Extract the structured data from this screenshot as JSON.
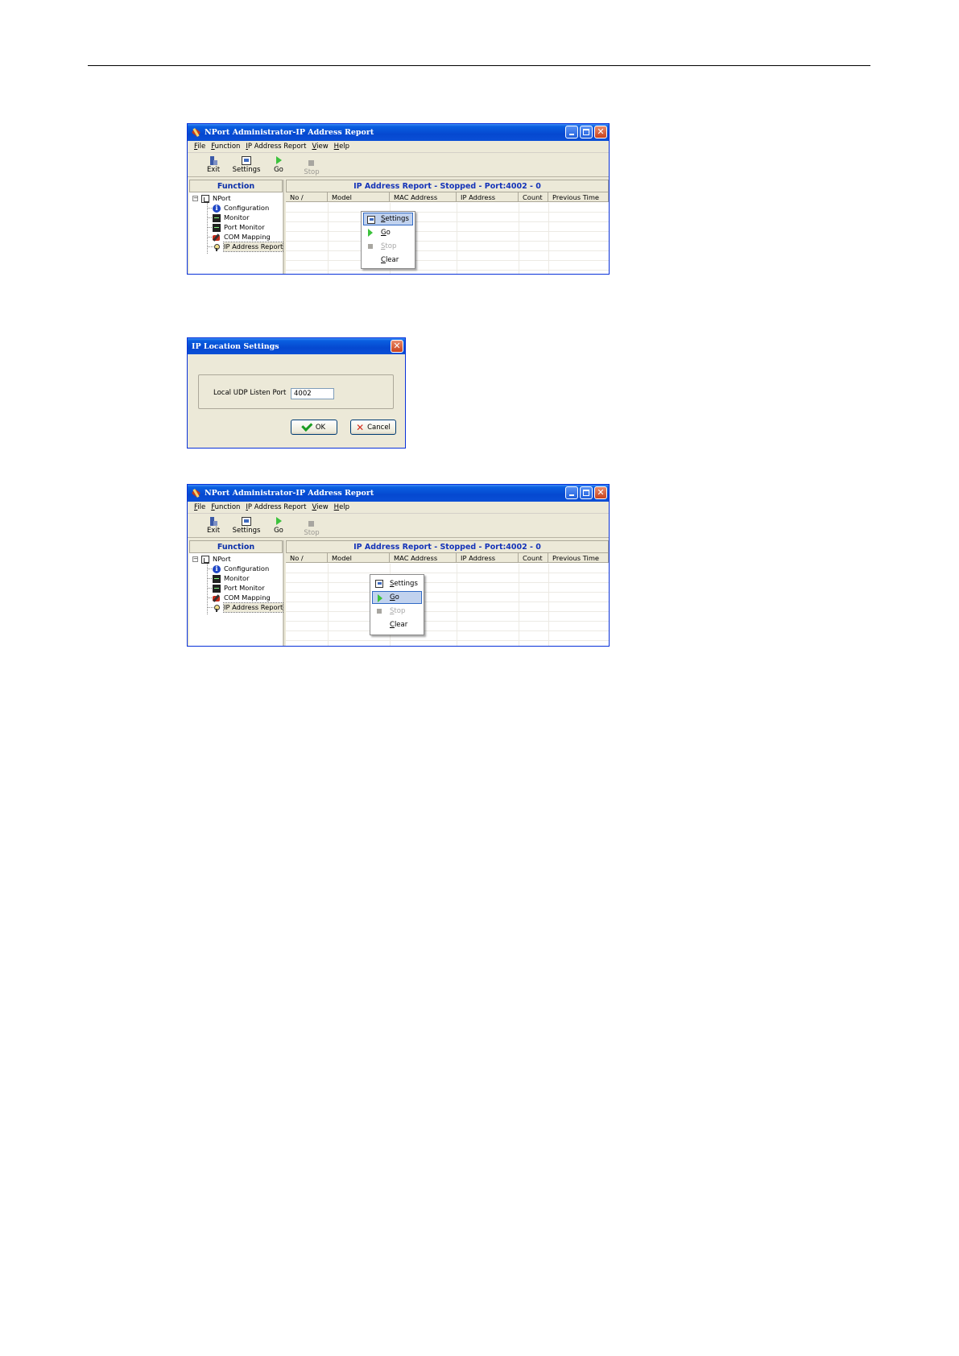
{
  "win1": {
    "title": "NPort Administrator-IP Address Report",
    "menu": [
      "File",
      "Function",
      "IP Address Report",
      "View",
      "Help"
    ],
    "toolbar": {
      "exit": "Exit",
      "settings": "Settings",
      "go": "Go",
      "stop": "Stop"
    },
    "function_header": "Function",
    "tree": {
      "root": "NPort",
      "items": [
        "Configuration",
        "Monitor",
        "Port Monitor",
        "COM Mapping",
        "IP Address Report"
      ]
    },
    "report_header": "IP Address Report - Stopped - Port:4002 - 0",
    "columns": [
      "No  /",
      "Model",
      "MAC Address",
      "IP Address",
      "Count",
      "Previous Time"
    ],
    "context_menu": [
      "Settings",
      "Go",
      "Stop",
      "Clear"
    ],
    "highlighted_item": "Settings"
  },
  "dialog": {
    "title": "IP Location Settings",
    "port_label": "Local UDP Listen Port",
    "port_value": "4002",
    "ok": "OK",
    "cancel": "Cancel"
  },
  "win2": {
    "title": "NPort Administrator-IP Address Report",
    "menu": [
      "File",
      "Function",
      "IP Address Report",
      "View",
      "Help"
    ],
    "toolbar": {
      "exit": "Exit",
      "settings": "Settings",
      "go": "Go",
      "stop": "Stop"
    },
    "function_header": "Function",
    "tree": {
      "root": "NPort",
      "items": [
        "Configuration",
        "Monitor",
        "Port Monitor",
        "COM Mapping",
        "IP Address Report"
      ]
    },
    "report_header": "IP Address Report - Stopped - Port:4002 - 0",
    "columns": [
      "No  /",
      "Model",
      "MAC Address",
      "IP Address",
      "Count",
      "Previous Time"
    ],
    "context_menu": [
      "Settings",
      "Go",
      "Stop",
      "Clear"
    ],
    "highlighted_item": "Go"
  }
}
